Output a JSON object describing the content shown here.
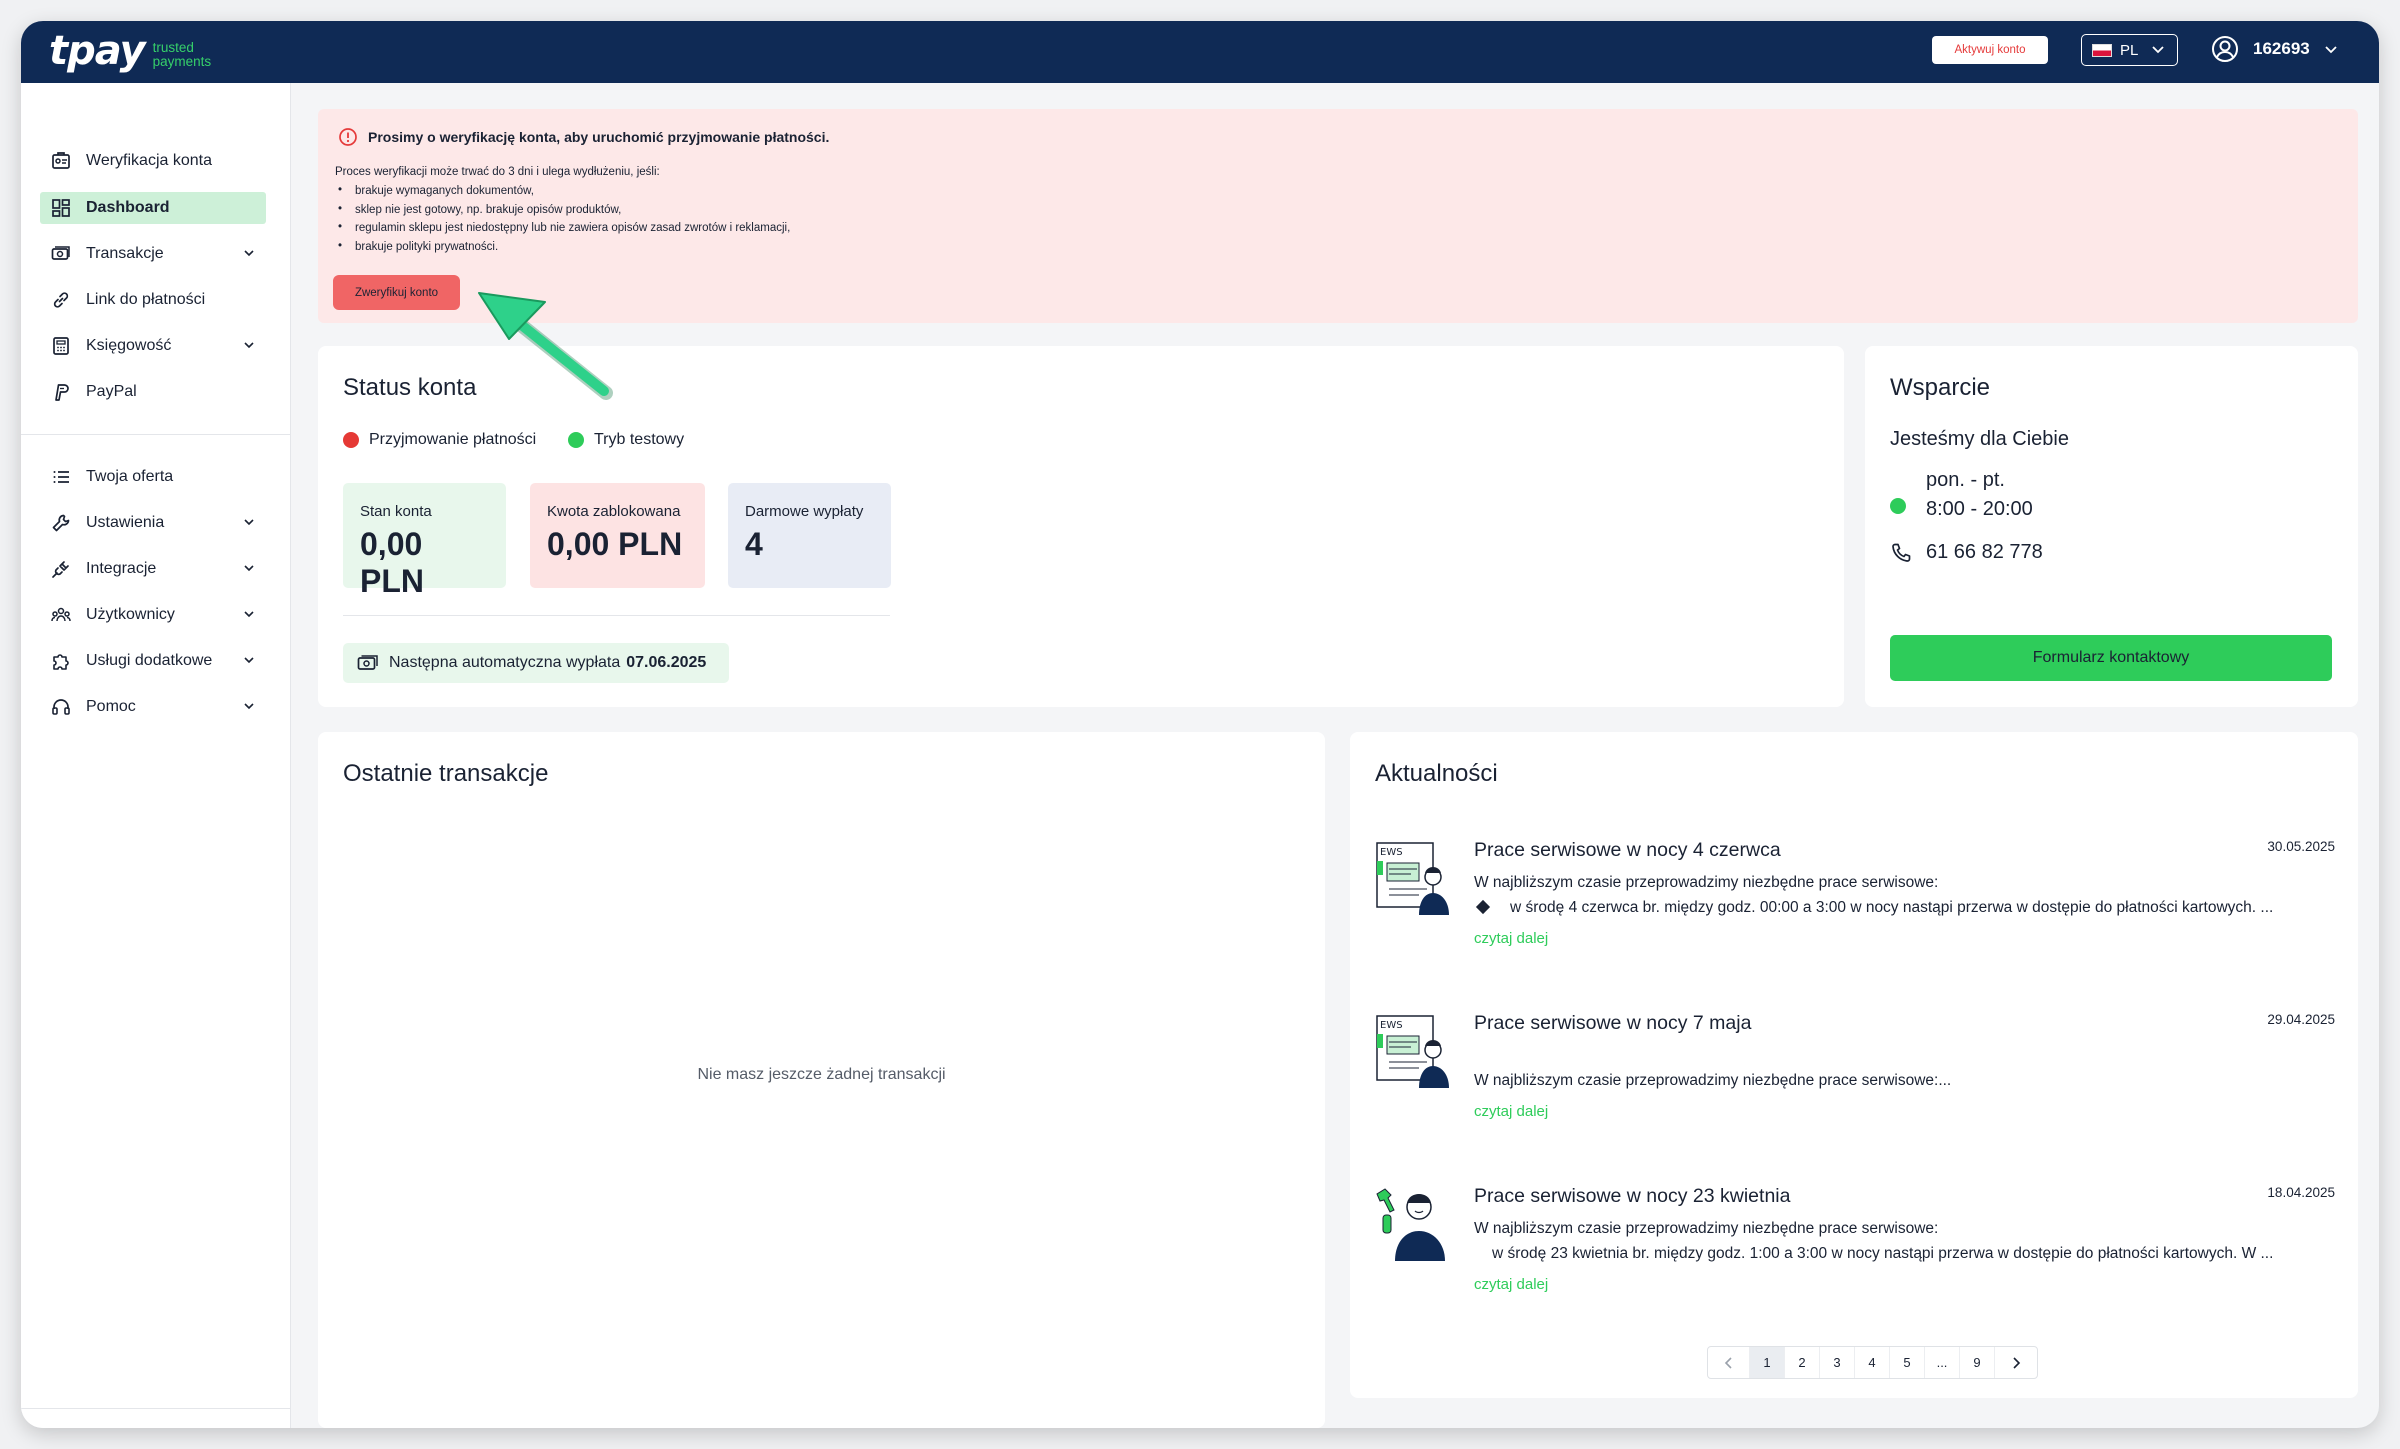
{
  "header": {
    "logo_text": "tpay",
    "logo_tagline_1": "trusted",
    "logo_tagline_2": "payments",
    "activate_label": "Aktywuj konto",
    "lang": "PL",
    "user_id": "162693"
  },
  "sidebar": {
    "group1": [
      {
        "label": "Weryfikacja konta",
        "icon": "verification-icon",
        "chevron": false
      },
      {
        "label": "Dashboard",
        "icon": "dashboard-icon",
        "chevron": false,
        "active": true
      },
      {
        "label": "Transakcje",
        "icon": "transactions-icon",
        "chevron": true
      },
      {
        "label": "Link do płatności",
        "icon": "link-icon",
        "chevron": false
      },
      {
        "label": "Księgowość",
        "icon": "calculator-icon",
        "chevron": true
      },
      {
        "label": "PayPal",
        "icon": "paypal-icon",
        "chevron": false
      }
    ],
    "group2": [
      {
        "label": "Twoja oferta",
        "icon": "list-icon",
        "chevron": false
      },
      {
        "label": "Ustawienia",
        "icon": "wrench-icon",
        "chevron": true
      },
      {
        "label": "Integracje",
        "icon": "plug-icon",
        "chevron": true
      },
      {
        "label": "Użytkownicy",
        "icon": "users-icon",
        "chevron": true
      },
      {
        "label": "Usługi dodatkowe",
        "icon": "puzzle-icon",
        "chevron": true
      },
      {
        "label": "Pomoc",
        "icon": "headset-icon",
        "chevron": true
      }
    ]
  },
  "alert": {
    "title": "Prosimy o weryfikację konta, aby uruchomić przyjmowanie płatności.",
    "intro": "Proces weryfikacji może trwać do 3 dni i ulega wydłużeniu, jeśli:",
    "items": [
      "brakuje wymaganych dokumentów,",
      "sklep nie jest gotowy, np. brakuje opisów produktów,",
      "regulamin sklepu jest niedostępny lub nie zawiera opisów zasad zwrotów i reklamacji,",
      "brakuje polityki prywatności."
    ],
    "button_label": "Zweryfikuj konto"
  },
  "status": {
    "title": "Status konta",
    "legend": [
      {
        "label": "Przyjmowanie płatności",
        "color": "#e53935"
      },
      {
        "label": "Tryb testowy",
        "color": "#2ecc5a"
      }
    ],
    "tiles": [
      {
        "label": "Stan konta",
        "value": "0,00 PLN",
        "bg": "#e8f7ec"
      },
      {
        "label": "Kwota zablokowana",
        "value": "0,00 PLN",
        "bg": "#fde3e3"
      },
      {
        "label": "Darmowe wypłaty",
        "value": "4",
        "bg": "#e8ecf5"
      }
    ],
    "payout_label": "Następna automatyczna wypłata",
    "payout_date": "07.06.2025"
  },
  "support": {
    "title": "Wsparcie",
    "subtitle": "Jesteśmy dla Ciebie",
    "days": "pon. - pt.",
    "hours": "8:00 - 20:00",
    "phone": "61 66 82 778",
    "button_label": "Formularz kontaktowy"
  },
  "transactions": {
    "title": "Ostatnie transakcje",
    "empty_text": "Nie masz jeszcze żadnej transakcji"
  },
  "news": {
    "title": "Aktualności",
    "read_more": "czytaj dalej",
    "items": [
      {
        "title": "Prace serwisowe  w nocy 4 czerwca",
        "date": "30.05.2025",
        "line1": "W najbliższym czasie przeprowadzimy niezbędne prace serwisowe:",
        "line2": "w środę 4 czerwca  br. między godz.  00:00 a 3:00 w nocy nastąpi przerwa w dostępie do płatności kartowych. ..."
      },
      {
        "title": "Prace serwisowe  w nocy 7 maja",
        "date": "29.04.2025",
        "line1": "W najbliższym czasie przeprowadzimy niezbędne prace serwisowe:..."
      },
      {
        "title": "Prace serwisowe  w nocy 23 kwietnia",
        "date": "18.04.2025",
        "line1": "W najbliższym czasie przeprowadzimy niezbędne prace serwisowe:",
        "line2": "w środę 23 kwietnia  br. między godz.  1:00 a 3:00 w nocy nastąpi przerwa w dostępie do płatności kartowych. W ..."
      }
    ],
    "pagination": [
      "1",
      "2",
      "3",
      "4",
      "5",
      "...",
      "9"
    ],
    "current_page": "1"
  },
  "colors": {
    "navy": "#0f2a55",
    "green": "#2ecc5a",
    "alert_bg": "#fde8e8",
    "alert_red": "#e53a3a"
  }
}
